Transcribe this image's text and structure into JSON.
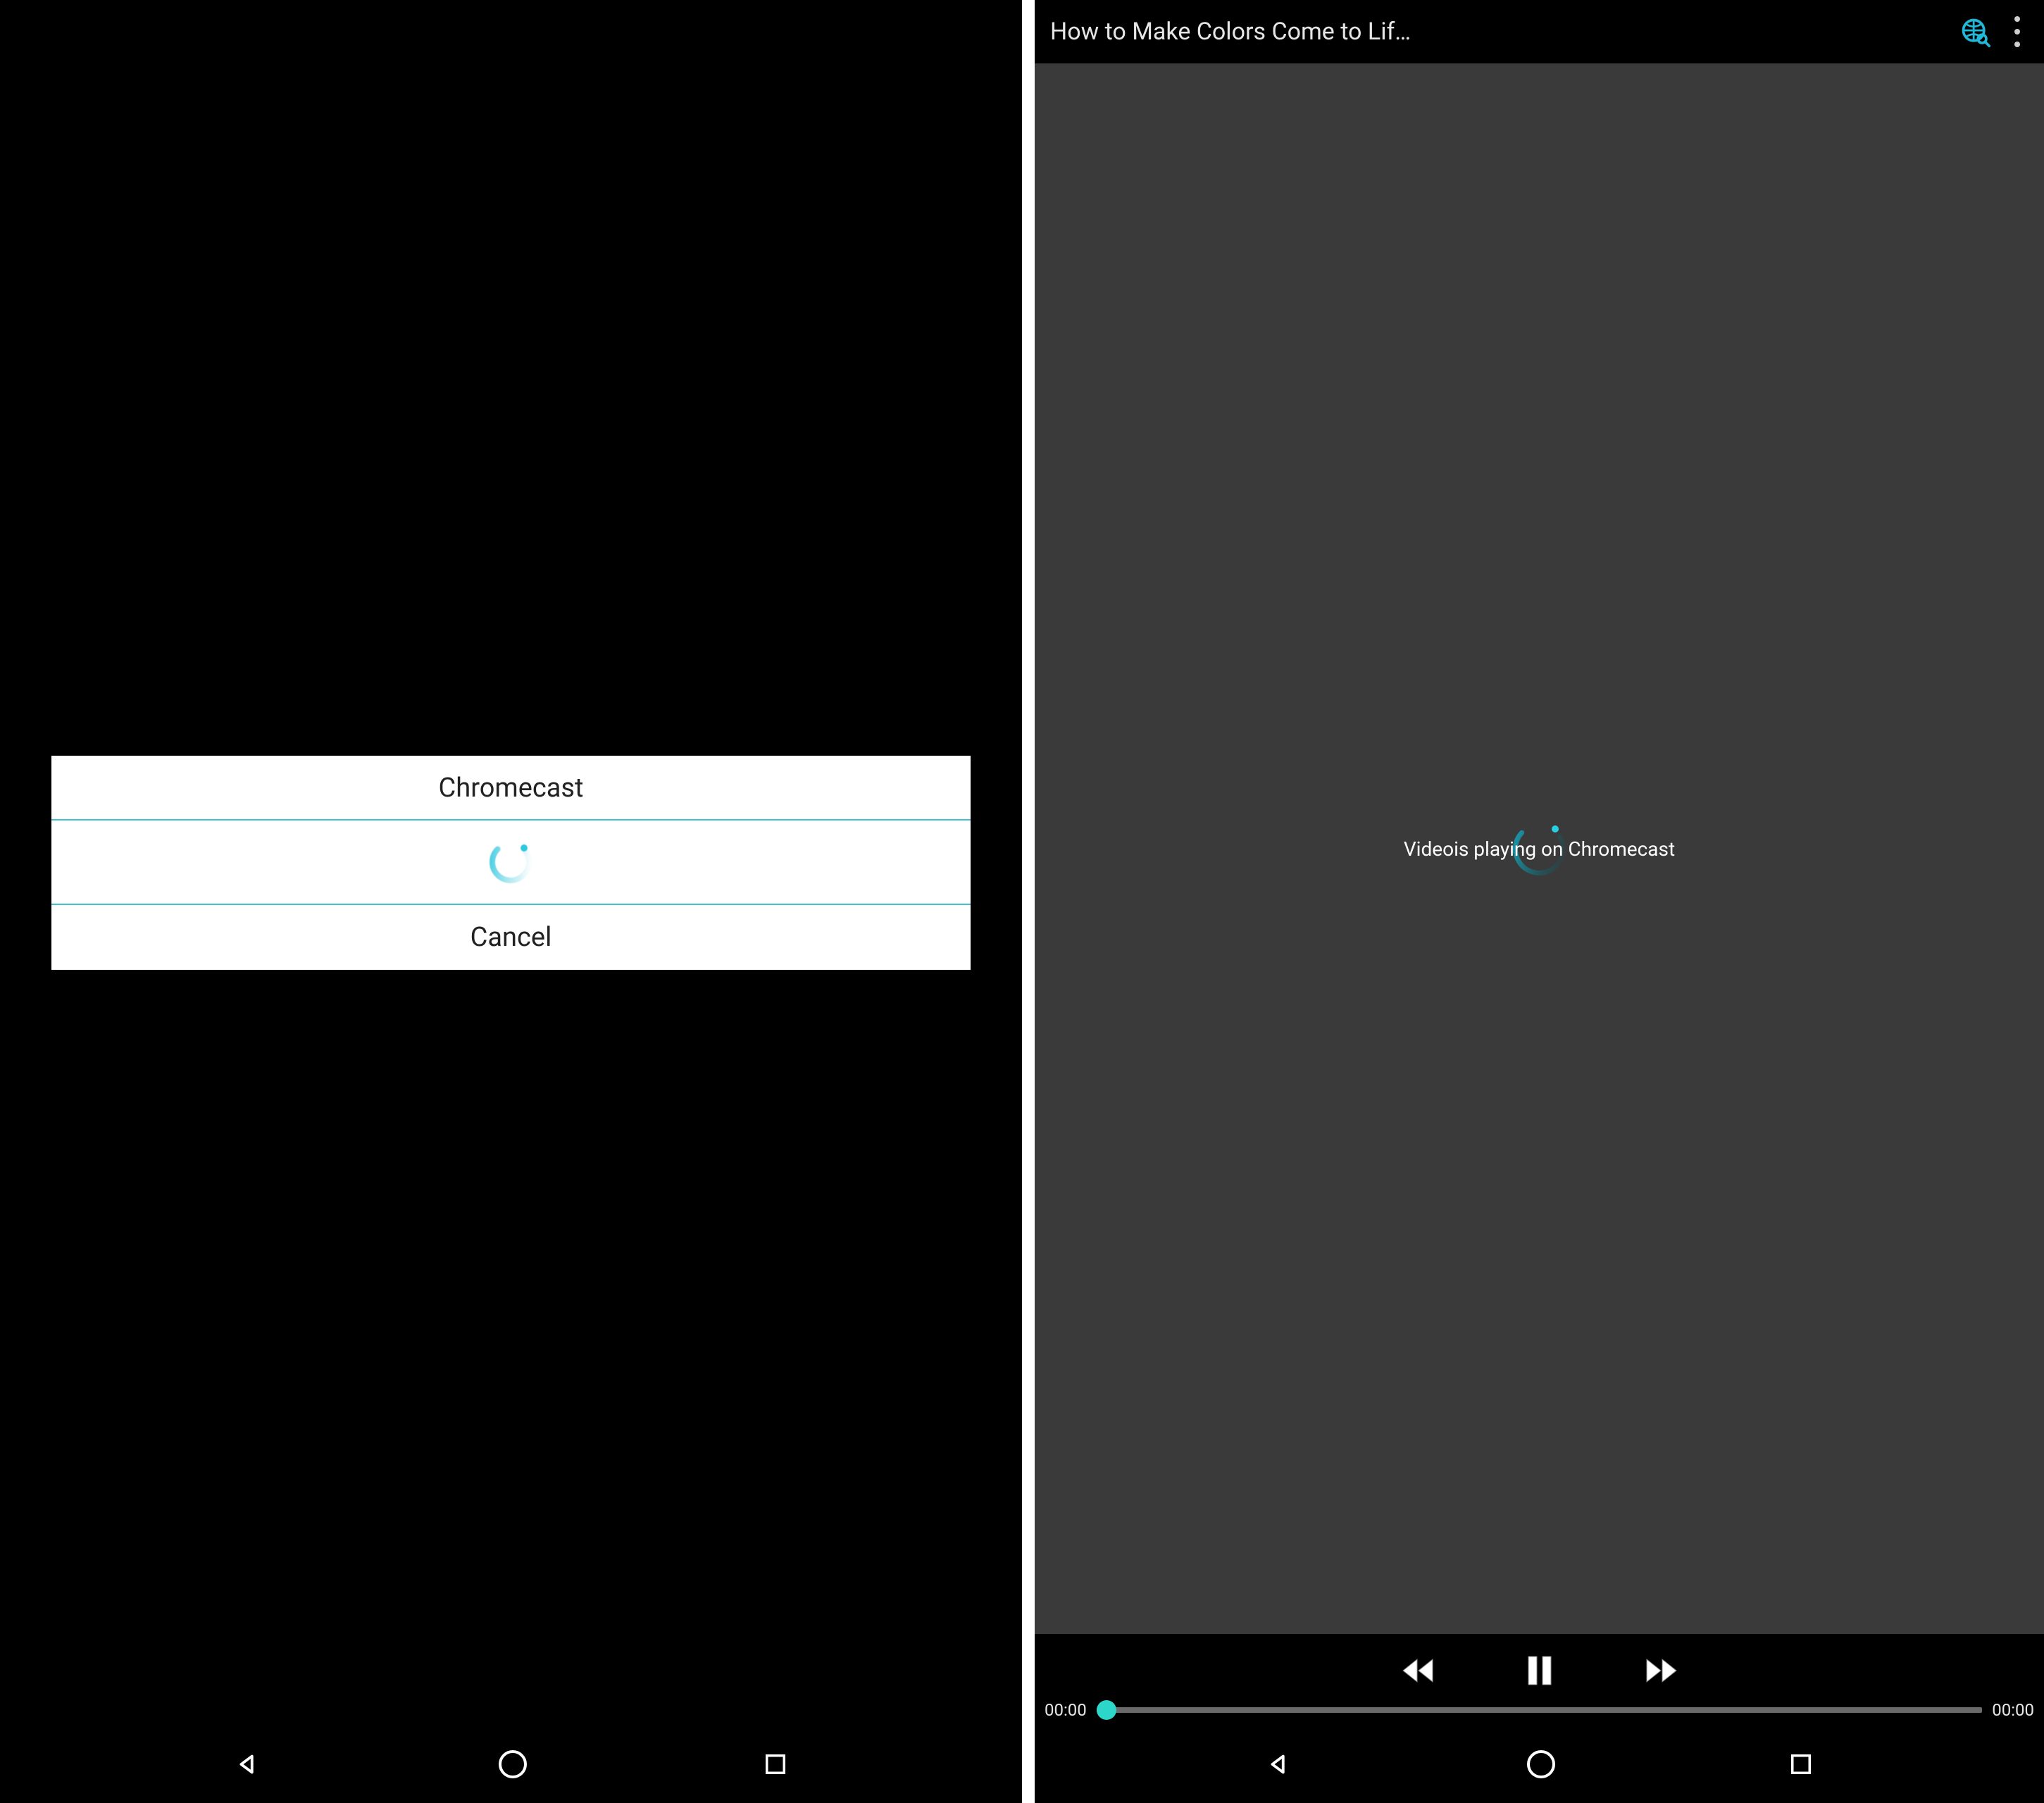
{
  "colors": {
    "accent": "#22b7d6",
    "thumb": "#2cd6c8",
    "divider": "#3fc2d6"
  },
  "left": {
    "dialog": {
      "title": "Chromecast",
      "cancel_label": "Cancel"
    }
  },
  "right": {
    "appbar": {
      "title": "How to Make Colors Come to Lif…"
    },
    "video": {
      "status_text": "Videois playing on Chromecast"
    },
    "progress": {
      "current": "00:00",
      "total": "00:00"
    }
  }
}
